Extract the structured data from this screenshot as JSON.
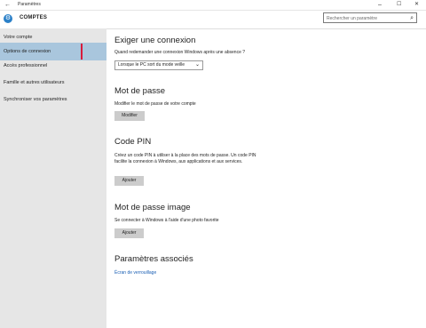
{
  "window": {
    "title": "Paramètres",
    "back_icon": "←",
    "minimize": "–",
    "maximize": "☐",
    "close": "✕"
  },
  "header": {
    "title": "COMPTES",
    "search_placeholder": "Rechercher un paramètre"
  },
  "sidebar": {
    "items": [
      {
        "label": "Votre compte",
        "selected": false
      },
      {
        "label": "Options de connexion",
        "selected": true
      },
      {
        "label": "Accès professionnel",
        "selected": false
      },
      {
        "label": "Famille et autres utilisateurs",
        "selected": false
      },
      {
        "label": "Synchroniser vos paramètres",
        "selected": false
      }
    ],
    "accent_color": "#d81b3c",
    "selected_color": "#a9c6dd"
  },
  "main": {
    "require": {
      "heading": "Exiger une connexion",
      "question": "Quand redemander une connexion Windows après une absence ?",
      "dropdown_value": "Lorsque le PC sort du mode veille"
    },
    "password": {
      "heading": "Mot de passe",
      "desc": "Modifier le mot de passe de votre compte",
      "button": "Modifier"
    },
    "pin": {
      "heading": "Code PIN",
      "desc": "Créez un code PIN à utiliser à la place des mots de passe. Un code PIN facilite la connexion à Windows, aux applications et aux services.",
      "button": "Ajouter"
    },
    "picture": {
      "heading": "Mot de passe image",
      "desc": "Se connecter à Windows à l'aide d'une photo favorite",
      "button": "Ajouter"
    },
    "related": {
      "heading": "Paramètres associés",
      "link": "Écran de verrouillage"
    }
  }
}
